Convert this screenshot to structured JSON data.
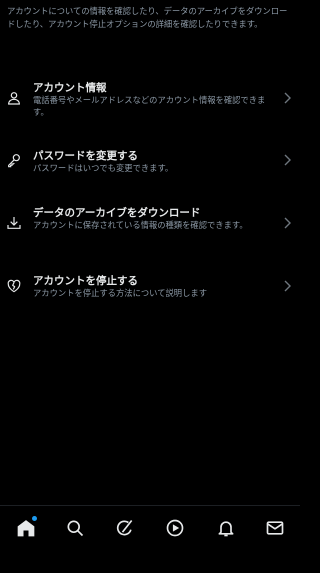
{
  "intro": {
    "text": "アカウントについての情報を確認したり、データのアーカイブをダウンロードしたり、アカウント停止オプションの詳細を確認したりできます。"
  },
  "menu": {
    "items": [
      {
        "icon": "person-icon",
        "title": "アカウント情報",
        "description": "電話番号やメールアドレスなどのアカウント情報を確認できます。"
      },
      {
        "icon": "key-icon",
        "title": "パスワードを変更する",
        "description": "パスワードはいつでも変更できます。"
      },
      {
        "icon": "download-icon",
        "title": "データのアーカイブをダウンロード",
        "description": "アカウントに保存されている情報の種類を確認できます。"
      },
      {
        "icon": "broken-heart-icon",
        "title": "アカウントを停止する",
        "description": "アカウントを停止する方法について説明します"
      }
    ]
  },
  "bottom_nav": {
    "items": [
      {
        "name": "home",
        "icon": "home-icon",
        "active": true,
        "badge": true
      },
      {
        "name": "search",
        "icon": "search-icon",
        "active": false
      },
      {
        "name": "grok",
        "icon": "grok-icon",
        "active": false
      },
      {
        "name": "video",
        "icon": "play-icon",
        "active": false
      },
      {
        "name": "notifications",
        "icon": "bell-icon",
        "active": false
      },
      {
        "name": "messages",
        "icon": "mail-icon",
        "active": false
      }
    ]
  },
  "colors": {
    "background": "#000000",
    "primary_text": "#e7e9ea",
    "secondary_text": "#8b98a5",
    "accent": "#1d9bf0"
  }
}
